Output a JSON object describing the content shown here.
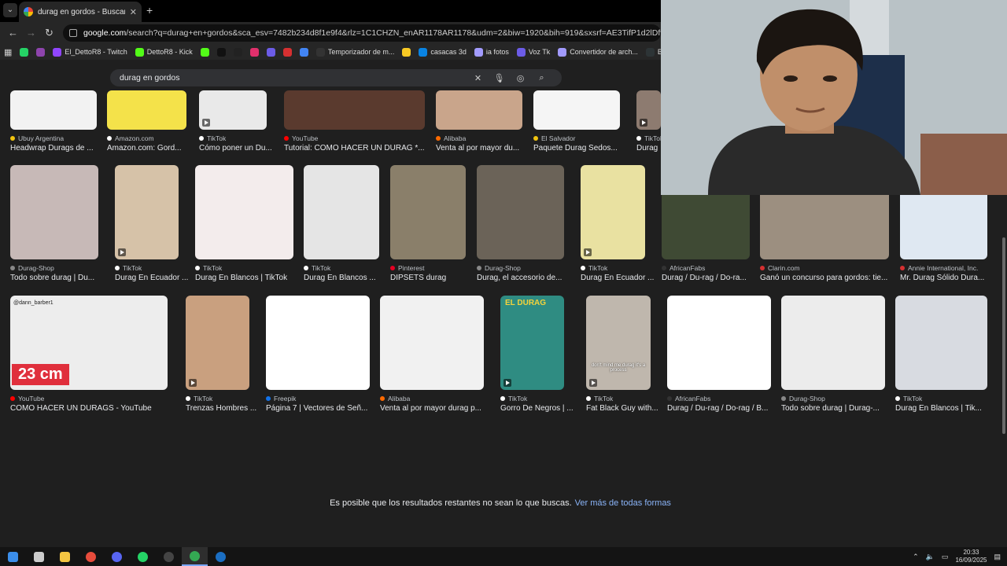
{
  "browser": {
    "tab_title": "durag en gordos - Buscar con G",
    "url": "google.com/search?q=durag+en+gordos&sca_esv=7482b234d8f1e9f4&rlz=1C1CHZN_enAR1178AR1178&udm=2&biw=1920&bih=919&sxsrf=AE3TifP1d2lDfvmA4k80yZircxeyA",
    "url_domain": "google.com",
    "url_rest": "/search?q=durag+en+gordos&sca_esv=7482b234d8f1e9f4&rlz=1C1CHZN_enAR1178AR1178&udm=2&biw=1920&bih=919&sxsrf=AE3TifP1d2lDfvmA4k80yZircxeyA",
    "bookmarks": [
      {
        "label": "",
        "color": "#25d366"
      },
      {
        "label": "",
        "color": "#8e44ad"
      },
      {
        "label": "El_DettoR8 - Twitch",
        "color": "#9146ff"
      },
      {
        "label": "DettoR8 - Kick",
        "color": "#53fc18"
      },
      {
        "label": "",
        "color": "#53fc18"
      },
      {
        "label": "",
        "color": "#111111"
      },
      {
        "label": "",
        "color": "#222222"
      },
      {
        "label": "",
        "color": "#e1306c"
      },
      {
        "label": "",
        "color": "#6c5ce7"
      },
      {
        "label": "",
        "color": "#d63031"
      },
      {
        "label": "",
        "color": "#4285f4"
      },
      {
        "label": "Temporizador de m...",
        "color": "#333333"
      },
      {
        "label": "",
        "color": "#f9ca24"
      },
      {
        "label": "casacas 3d",
        "color": "#0984e3"
      },
      {
        "label": "ia fotos",
        "color": "#a29bfe"
      },
      {
        "label": "Voz Tk",
        "color": "#6c5ce7"
      },
      {
        "label": "Convertidor de arch...",
        "color": "#a29bfe"
      },
      {
        "label": "Bot",
        "color": "#2d3436"
      }
    ]
  },
  "search": {
    "query": "durag en gordos",
    "clear_icon": "close-icon",
    "voice_icon": "mic-icon",
    "lens_icon": "camera-icon",
    "search_icon": "search-icon"
  },
  "results": [
    {
      "source": "Ubuy Argentina",
      "title": "Headwrap Durags de ...",
      "src_color": "#f1c40f",
      "bg": "#f2f2f2",
      "video": false
    },
    {
      "source": "Amazon.com",
      "title": "Amazon.com: Gord...",
      "src_color": "#ffffff",
      "bg": "#f4e24a",
      "video": false
    },
    {
      "source": "TikTok",
      "title": "Cómo poner un Du...",
      "src_color": "#ffffff",
      "bg": "#e9e9e9",
      "video": true
    },
    {
      "source": "YouTube",
      "title": "Tutorial: COMO HACER UN DURAG *...",
      "src_color": "#ff0000",
      "bg": "#5a3a2e",
      "video": false
    },
    {
      "source": "Alibaba",
      "title": "Venta al por mayor du...",
      "src_color": "#ff6a00",
      "bg": "#c9a58b",
      "video": false
    },
    {
      "source": "El Salvador",
      "title": "Paquete Durag Sedos...",
      "src_color": "#f1c40f",
      "bg": "#f5f5f5",
      "video": false
    },
    {
      "source": "TikTok",
      "title": "Durag E...",
      "src_color": "#ffffff",
      "bg": "#8d7b70",
      "video": true
    },
    {
      "source": "Durag-Shop",
      "title": "Todo sobre durag | Du...",
      "src_color": "#888888",
      "bg": "#c7b9b7",
      "video": false
    },
    {
      "source": "TikTok",
      "title": "Durag En Ecuador ...",
      "src_color": "#ffffff",
      "bg": "#d6c2a8",
      "video": true
    },
    {
      "source": "TikTok",
      "title": "Durag En Blancos | TikTok",
      "src_color": "#ffffff",
      "bg": "#f3ecec",
      "video": false
    },
    {
      "source": "TikTok",
      "title": "Durag En Blancos ...",
      "src_color": "#ffffff",
      "bg": "#e5e5e5",
      "video": false
    },
    {
      "source": "Pinterest",
      "title": "DIPSETS durag",
      "src_color": "#e60023",
      "bg": "#8a7f6a",
      "video": false
    },
    {
      "source": "Durag-Shop",
      "title": "Durag, el accesorio de...",
      "src_color": "#888888",
      "bg": "#6b6358",
      "video": false
    },
    {
      "source": "TikTok",
      "title": "Durag En Ecuador ...",
      "src_color": "#ffffff",
      "bg": "#e9e1a1",
      "video": true
    },
    {
      "source": "AfricanFabs",
      "title": "Durag / Du-rag / Do-ra...",
      "src_color": "#333333",
      "bg": "#3f4a34",
      "video": false
    },
    {
      "source": "Clarin.com",
      "title": "Ganó un concurso para gordos: tie...",
      "src_color": "#d63031",
      "bg": "#9c8f80",
      "video": false
    },
    {
      "source": "Annie International, Inc.",
      "title": "Mr. Durag Sólido Dura...",
      "src_color": "#d63031",
      "bg": "#dfe8f2",
      "video": false
    },
    {
      "source": "YouTube",
      "title": "COMO HACER UN DURAGS - YouTube",
      "src_color": "#ff0000",
      "bg": "#ededed",
      "video": false,
      "overlay": "23 cm",
      "tag": "@dann_barber1"
    },
    {
      "source": "TikTok",
      "title": "Trenzas Hombres ...",
      "src_color": "#ffffff",
      "bg": "#c9a07f",
      "video": true
    },
    {
      "source": "Freepik",
      "title": "Página 7 | Vectores de Señ...",
      "src_color": "#1273eb",
      "bg": "#ffffff",
      "video": false
    },
    {
      "source": "Alibaba",
      "title": "Venta al por mayor durag p...",
      "src_color": "#ff6a00",
      "bg": "#f1f1f1",
      "video": false
    },
    {
      "source": "TikTok",
      "title": "Gorro De Negros | ...",
      "src_color": "#ffffff",
      "bg": "#2f8c82",
      "video": true,
      "overlay_small": "EL DURAG"
    },
    {
      "source": "TikTok",
      "title": "Fat Black Guy with...",
      "src_color": "#ffffff",
      "bg": "#bfb7ad",
      "video": true,
      "overlay_caption": "don't mind me durag it's a process"
    },
    {
      "source": "AfricanFabs",
      "title": "Durag / Du-rag / Do-rag / B...",
      "src_color": "#333333",
      "bg": "#ffffff",
      "video": false
    },
    {
      "source": "Durag-Shop",
      "title": "Todo sobre durag | Durag-...",
      "src_color": "#888888",
      "bg": "#ececec",
      "video": false
    },
    {
      "source": "TikTok",
      "title": "Durag En Blancos | Tik...",
      "src_color": "#ffffff",
      "bg": "#d8dbe1",
      "video": false
    }
  ],
  "notice": {
    "text": "Es posible que los resultados restantes no sean lo que buscas.",
    "link": "Ver más de todas formas"
  },
  "taskbar": {
    "icons": [
      {
        "name": "windows-start-icon",
        "color": "#3b8eea"
      },
      {
        "name": "task-view-icon",
        "color": "#cccccc"
      },
      {
        "name": "file-explorer-icon",
        "color": "#f4c542"
      },
      {
        "name": "app-red-icon",
        "color": "#e74c3c"
      },
      {
        "name": "discord-icon",
        "color": "#5865f2"
      },
      {
        "name": "whatsapp-icon",
        "color": "#25d366"
      },
      {
        "name": "obs-icon",
        "color": "#444444"
      },
      {
        "name": "chrome-icon",
        "color": "#34a853"
      },
      {
        "name": "steam-icon",
        "color": "#1b6ec2"
      }
    ],
    "time": "20:33",
    "date": "16/09/2025"
  }
}
